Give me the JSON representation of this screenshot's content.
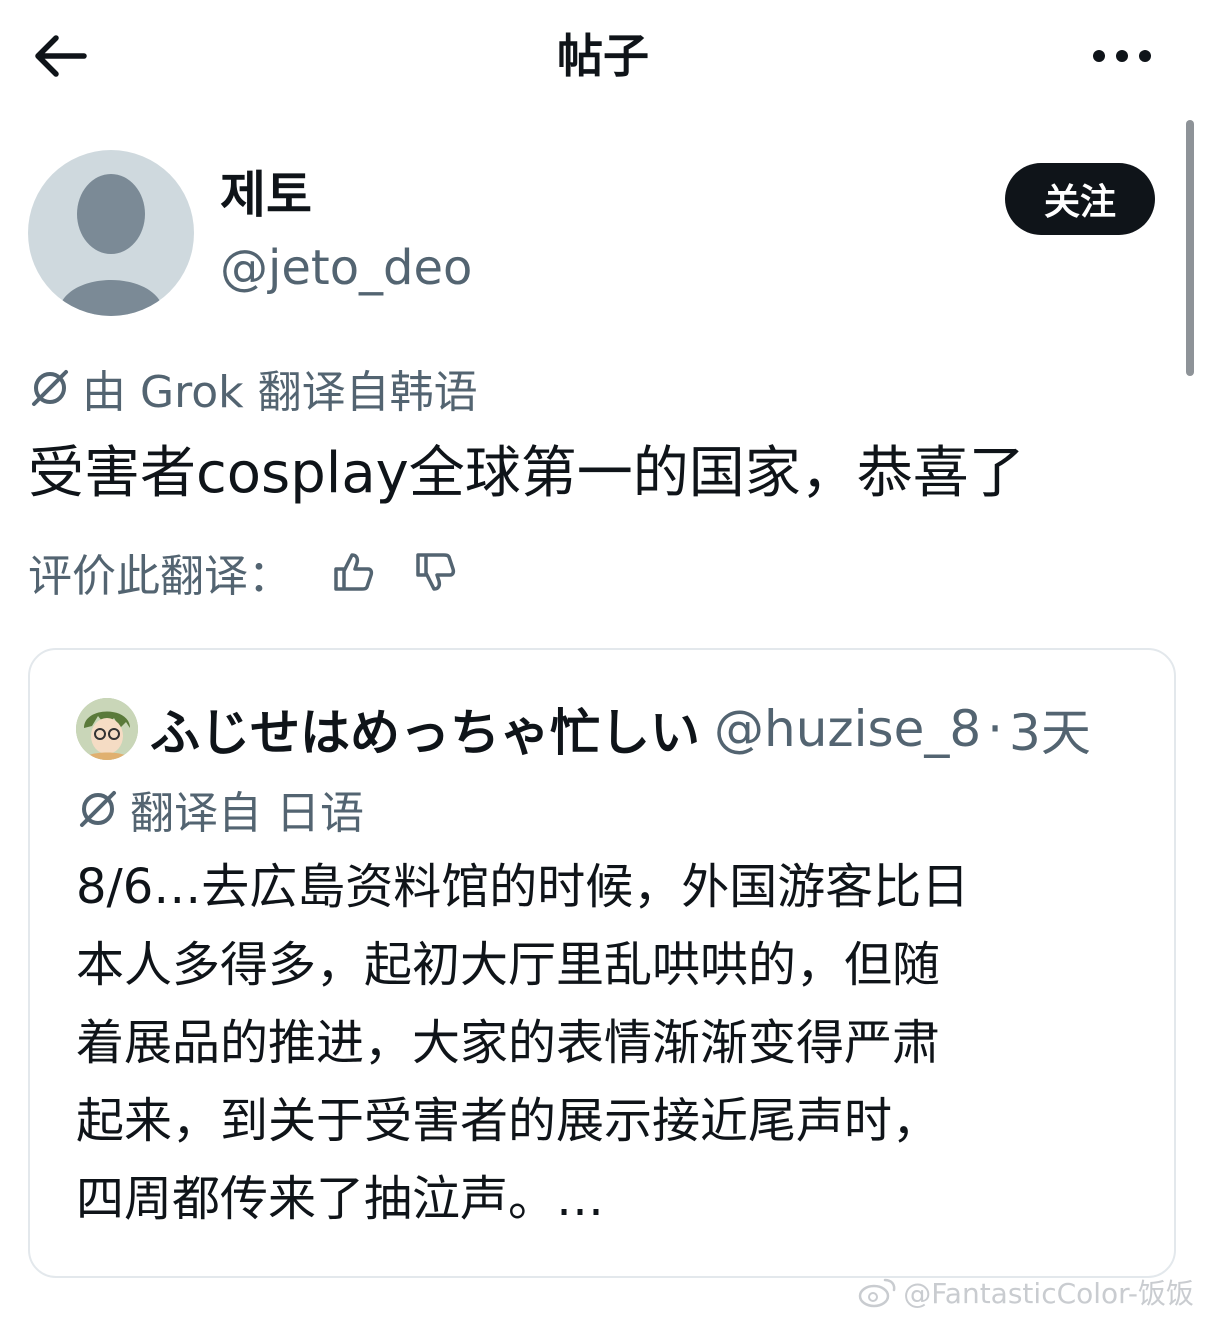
{
  "header": {
    "title": "帖子",
    "back_icon": "arrow-left-icon",
    "more_icon": "more-horizontal-icon"
  },
  "author": {
    "name": "제토",
    "handle": "@jeto_deo",
    "follow_label": "关注"
  },
  "translation": {
    "label": "由 Grok 翻译自韩语",
    "post_text": "受害者cosplay全球第一的国家，恭喜了",
    "rate_label": "评价此翻译："
  },
  "quote": {
    "name": "ふじせはめっちゃ忙しい",
    "handle": "@huzise_8",
    "dot": "·",
    "time": "3天",
    "translation_label": "翻译自 日语",
    "text": "8/6…去広島资料馆的时候，外国游客比日\n本人多得多，起初大厅里乱哄哄的，但随\n着展品的推进，大家的表情渐渐变得严肃\n起来，到关于受害者的展示接近尾声时，\n四周都传来了抽泣声。…"
  },
  "watermark": {
    "text": "@FantasticColor-饭饭"
  },
  "colors": {
    "text_primary": "#0f1419",
    "text_secondary": "#536471",
    "border": "#e3e8ec",
    "button_bg": "#0f1419"
  }
}
